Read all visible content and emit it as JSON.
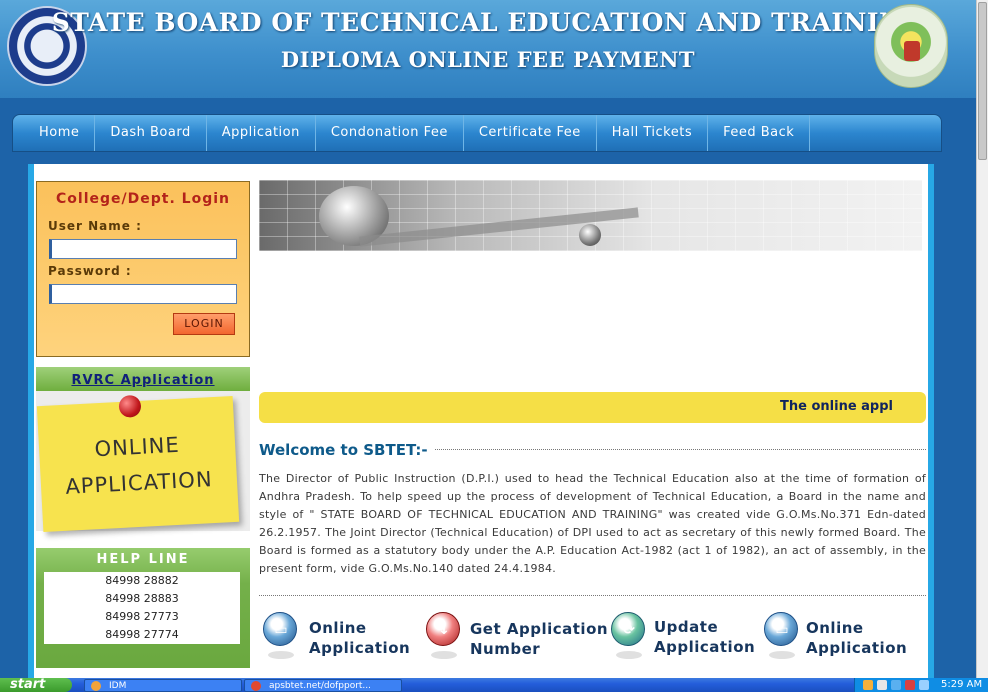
{
  "header": {
    "title": "STATE BOARD OF TECHNICAL EDUCATION AND TRAINING",
    "subtitle": "DIPLOMA ONLINE FEE PAYMENT"
  },
  "nav": {
    "items": [
      "Home",
      "Dash Board",
      "Application",
      "Condonation Fee",
      "Certificate Fee",
      "Hall Tickets",
      "Feed Back"
    ]
  },
  "login": {
    "title": "College/Dept. Login",
    "username_label": "User Name :",
    "username_value": "",
    "password_label": "Password :",
    "password_value": "",
    "button": "LOGIN"
  },
  "rvrc": {
    "link": "RVRC Application",
    "note_line1": "ONLINE",
    "note_line2": "APPLICATION"
  },
  "helpline": {
    "title": "HELP LINE",
    "numbers": [
      "84998 28882",
      "84998 28883",
      "84998 27773",
      "84998 27774"
    ]
  },
  "marquee": {
    "text": "The online appli"
  },
  "welcome": {
    "title": "Welcome to SBTET:-",
    "paragraph": "The Director of Public Instruction (D.P.I.) used to head the Technical Education also at the time of formation of Andhra Pradesh. To help speed up the process of development of Technical Education, a Board in the name and style of \" STATE BOARD OF TECHNICAL EDUCATION AND TRAINING\" was created vide G.O.Ms.No.371 Edn-dated 26.2.1957. The Joint Director (Technical Education) of DPI used to act as secretary of this newly formed Board. The Board is formed as a statutory body under the A.P. Education Act-1982 (act 1 of 1982), an act of assembly, in the present form, vide G.O.Ms.No.140 dated 24.4.1984."
  },
  "actions": [
    {
      "line1": "Online",
      "line2": "Application",
      "icon": "computer-icon"
    },
    {
      "line1": "Get Application",
      "line2": "Number",
      "icon": "download-icon"
    },
    {
      "line1": "Update",
      "line2": "Application",
      "icon": "refresh-icon"
    },
    {
      "line1": "Online",
      "line2": "Application",
      "icon": "computer-icon"
    }
  ],
  "taskbar": {
    "start": "start",
    "tasks": [
      "IDM",
      "apsbtet.net/dofpport..."
    ],
    "clock": "5:29 AM"
  },
  "colors": {
    "header_blue": "#3e8fcc",
    "nav_blue": "#2c86cf",
    "login_orange": "#fbc15b",
    "help_green": "#74b04a",
    "marquee_yellow": "#f5df46"
  }
}
